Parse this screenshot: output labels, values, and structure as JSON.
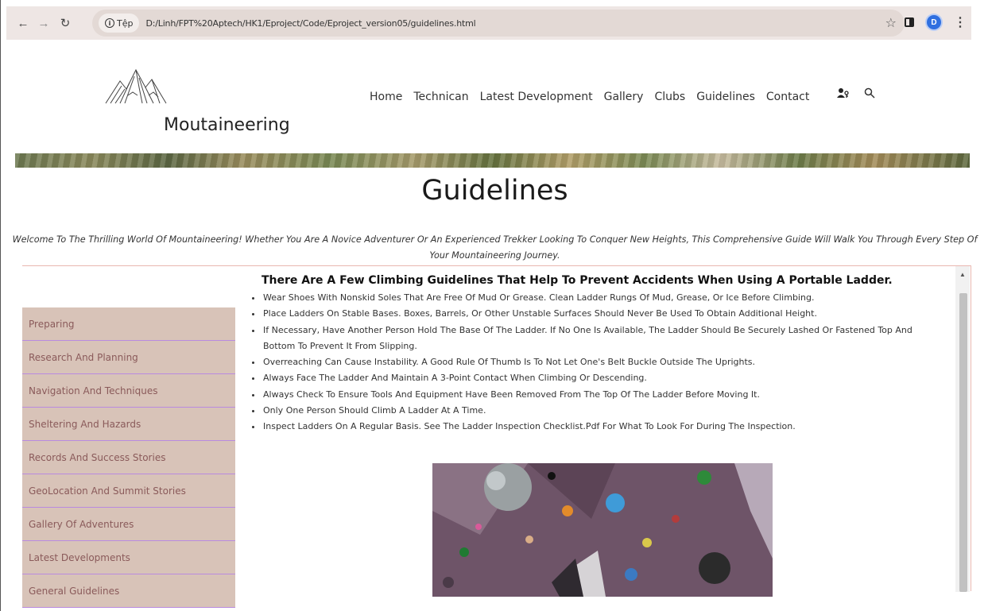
{
  "browser": {
    "site_info": "Tệp",
    "url": "D:/Linh/FPT%20Aptech/HK1/Eproject/Code/Eproject_version05/guidelines.html",
    "profile_initial": "D"
  },
  "header": {
    "brand": "Moutaineering",
    "nav": [
      "Home",
      "Technican",
      "Latest Development",
      "Gallery",
      "Clubs",
      "Guidelines",
      "Contact"
    ]
  },
  "page": {
    "title": "Guidelines",
    "intro": "Welcome To The Thrilling World Of Mountaineering! Whether You Are A Novice Adventurer Or An Experienced Trekker Looking To Conquer New Heights, This Comprehensive Guide Will Walk You Through Every Step Of Your Mountaineering Journey."
  },
  "sidebar": {
    "items": [
      "Preparing",
      "Research And Planning",
      "Navigation And Techniques",
      "Sheltering And Hazards",
      "Records And Success Stories",
      "GeoLocation And Summit Stories",
      "Gallery Of Adventures",
      "Latest Developments",
      "General Guidelines"
    ]
  },
  "main": {
    "heading": "There Are A Few Climbing Guidelines That Help To Prevent Accidents When Using A Portable Ladder.",
    "bullets": [
      "Wear Shoes With Nonskid Soles That Are Free Of Mud Or Grease. Clean Ladder Rungs Of Mud, Grease, Or Ice Before Climbing.",
      "Place Ladders On Stable Bases. Boxes, Barrels, Or Other Unstable Surfaces Should Never Be Used To Obtain Additional Height.",
      "If Necessary, Have Another Person Hold The Base Of The Ladder. If No One Is Available, The Ladder Should Be Securely Lashed Or Fastened Top And Bottom To Prevent It From Slipping.",
      "Overreaching Can Cause Instability. A Good Rule Of Thumb Is To Not Let One's Belt Buckle Outside The Uprights.",
      "Always Face The Ladder And Maintain A 3-Point Contact When Climbing Or Descending.",
      "Always Check To Ensure Tools And Equipment Have Been Removed From The Top Of The Ladder Before Moving It.",
      "Only One Person Should Climb A Ladder At A Time.",
      "Inspect Ladders On A Regular Basis. See The Ladder Inspection Checklist.Pdf For What To Look For During The Inspection."
    ]
  },
  "icons": {
    "back": "back-arrow-icon",
    "forward": "forward-arrow-icon",
    "reload": "reload-icon",
    "info": "info-icon",
    "bookmark": "star-icon",
    "side_panel": "side-panel-icon",
    "menu": "kebab-menu-icon",
    "user": "user-icon",
    "search": "search-icon",
    "logo": "mountain-logo-icon"
  },
  "colors": {
    "sidebar_bg": "#d8c3b8",
    "sidebar_text": "#8a5a5a",
    "sidebar_divider": "#b98ae0",
    "content_border": "#e9b7b0",
    "chrome_bg": "#eee6e4"
  }
}
